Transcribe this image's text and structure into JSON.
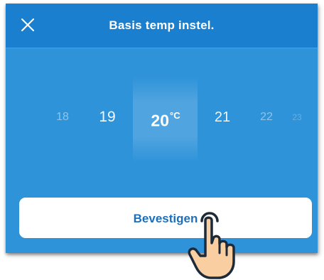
{
  "header": {
    "title": "Basis temp instel.",
    "close_icon": "close-icon"
  },
  "picker": {
    "values": [
      "18",
      "19",
      "20",
      "21",
      "22",
      "23"
    ],
    "selected": "20",
    "unit": "°C"
  },
  "confirm": {
    "label": "Bevestigen"
  },
  "overlay": {
    "pointer_icon": "hand-pointer-icon"
  },
  "colors": {
    "header_bg": "#1b7fd0",
    "body_bg": "#2f93d9",
    "button_text": "#1b6fbd",
    "hand_fill": "#f9cfa2"
  }
}
